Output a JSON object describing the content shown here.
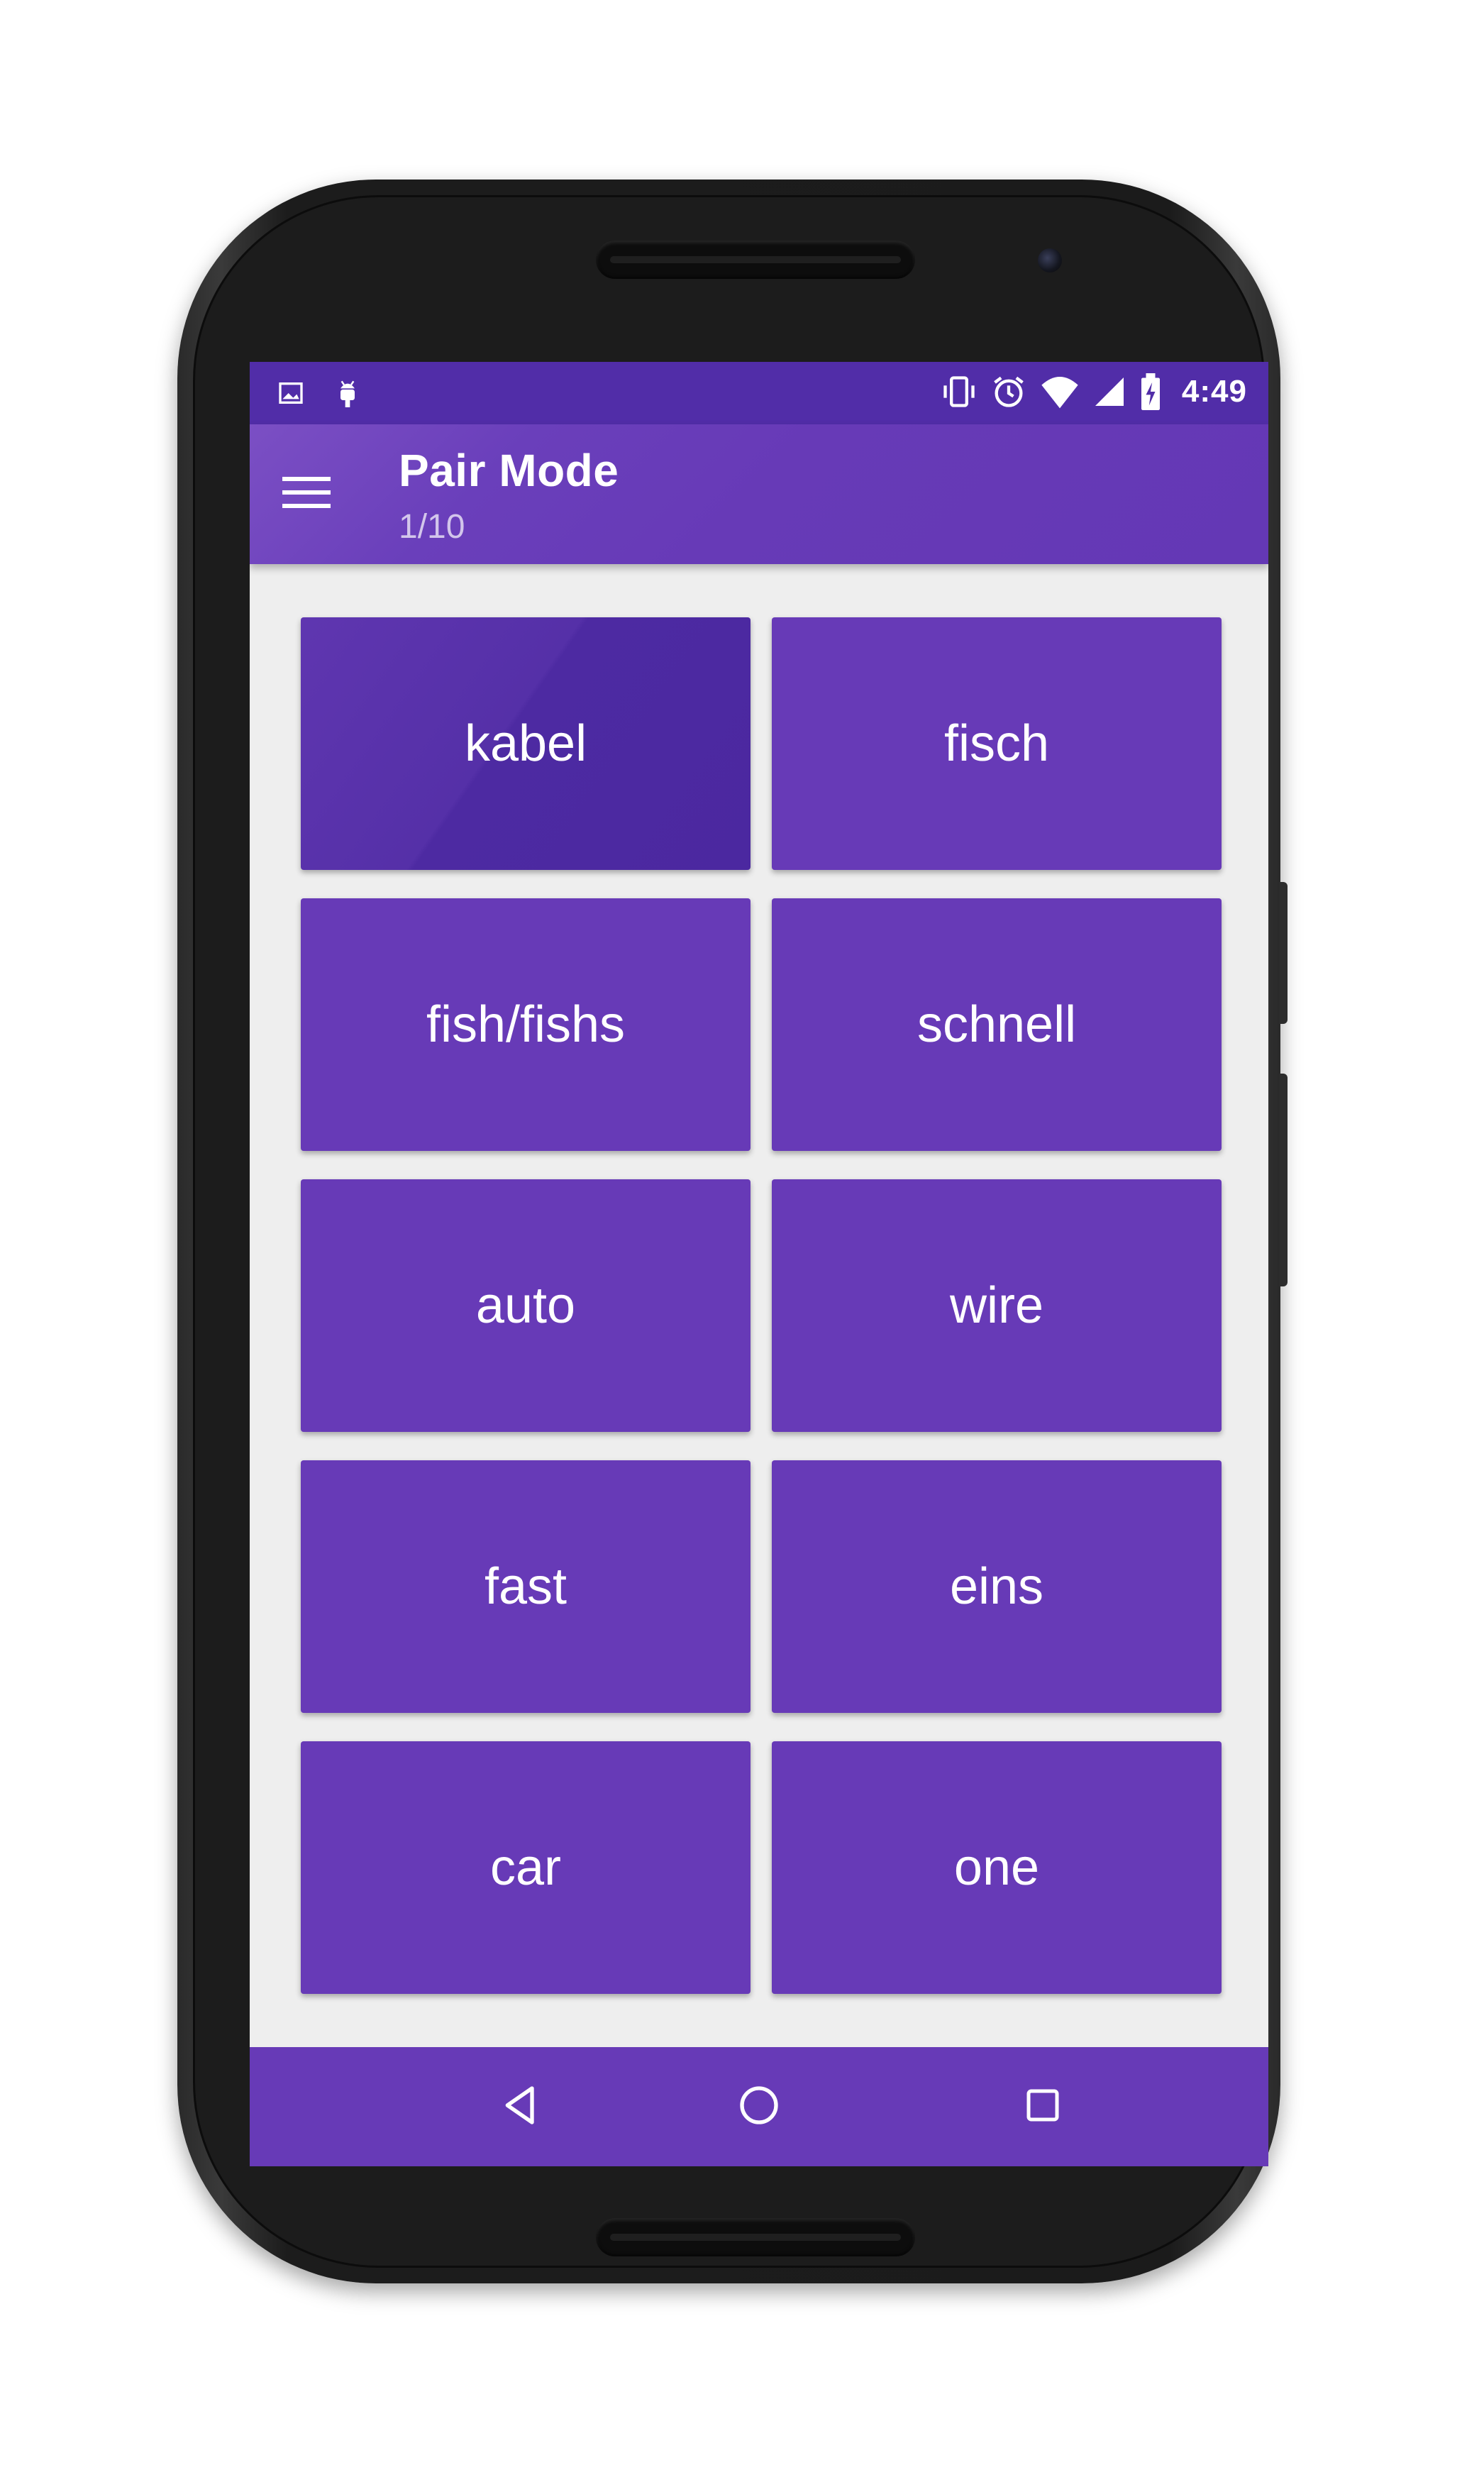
{
  "status_bar": {
    "time": "4:49",
    "left_icons": [
      "image-notification-icon",
      "android-debug-icon"
    ],
    "right_icons": [
      "vibrate-icon",
      "alarm-icon",
      "wifi-icon",
      "cell-signal-icon",
      "battery-charging-icon"
    ]
  },
  "app_bar": {
    "menu_icon": "hamburger-menu-icon",
    "title": "Pair Mode",
    "subtitle": "1/10"
  },
  "tiles": [
    {
      "label": "kabel",
      "selected": true
    },
    {
      "label": "fisch",
      "selected": false
    },
    {
      "label": "fish/fishs",
      "selected": false
    },
    {
      "label": "schnell",
      "selected": false
    },
    {
      "label": "auto",
      "selected": false
    },
    {
      "label": "wire",
      "selected": false
    },
    {
      "label": "fast",
      "selected": false
    },
    {
      "label": "eins",
      "selected": false
    },
    {
      "label": "car",
      "selected": false
    },
    {
      "label": "one",
      "selected": false
    }
  ],
  "nav_bar": {
    "icons": [
      "back-triangle-icon",
      "home-circle-icon",
      "recents-square-icon"
    ]
  },
  "colors": {
    "primary": "#673ab7",
    "primary_dark": "#512da8",
    "background": "#eeeeee"
  }
}
